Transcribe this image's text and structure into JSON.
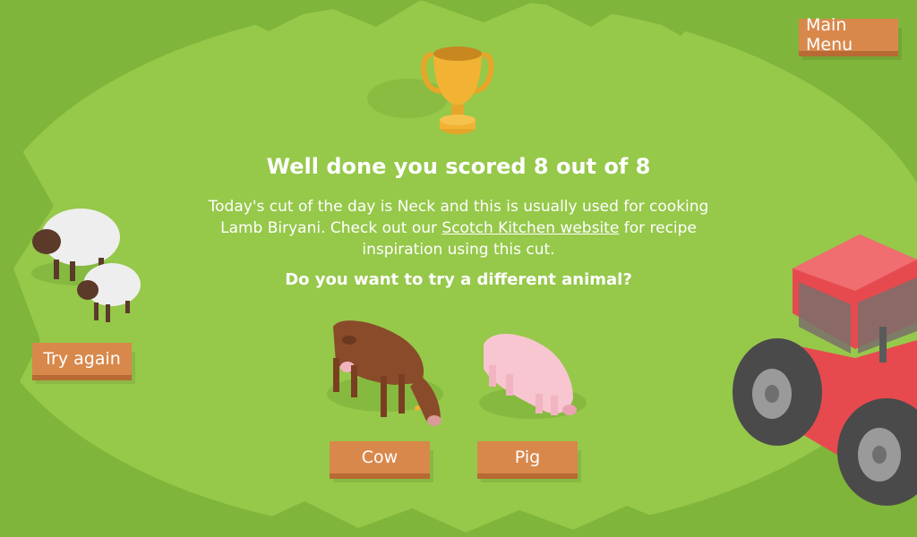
{
  "header": {
    "main_menu_label": "Main Menu"
  },
  "result": {
    "title": "Well done you scored 8 out of 8",
    "message_part1": "Today's cut of the day is Neck and this is usually used for cooking Lamb Biryani. Check out our ",
    "link_text": "Scotch Kitchen website",
    "message_part2": " for recipe inspiration using this cut.",
    "question": "Do you want to try a different animal?"
  },
  "actions": {
    "try_again_label": "Try again",
    "cow_label": "Cow",
    "pig_label": "Pig"
  },
  "colors": {
    "grass_light": "#96c84a",
    "grass_dark": "#7fb53a",
    "button": "#d8884b",
    "tractor_red": "#e64a4f",
    "trophy_gold": "#f2b233"
  }
}
